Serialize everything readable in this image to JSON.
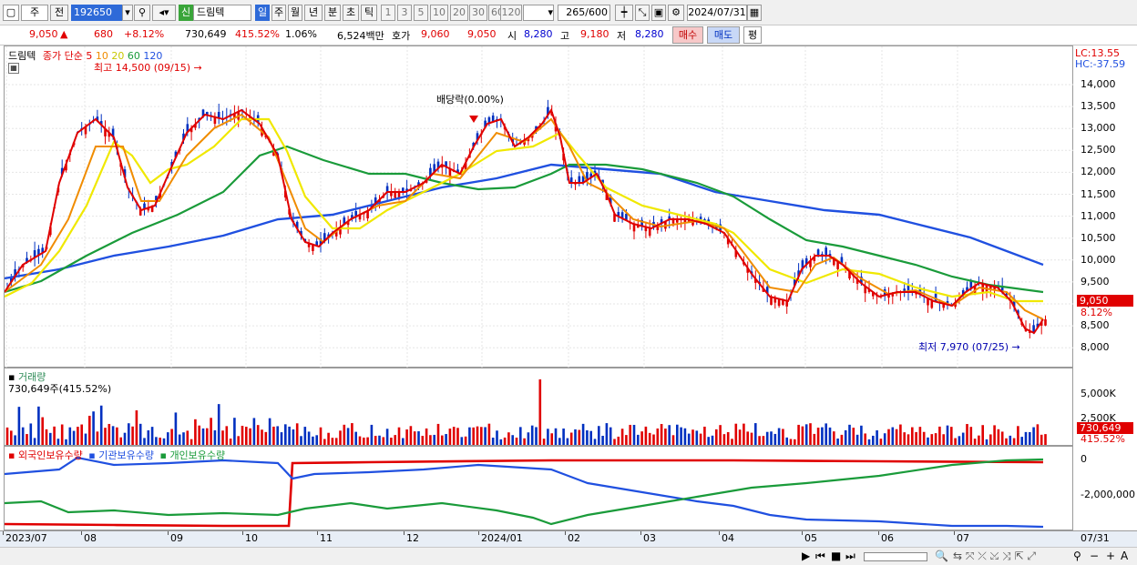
{
  "toolbar": {
    "period": "주",
    "prev": "전",
    "code": "192650",
    "credit": "신",
    "name": "드림텍",
    "periods": [
      "일",
      "주",
      "월",
      "년",
      "분",
      "초",
      "틱"
    ],
    "intervals": [
      "1",
      "3",
      "5",
      "10",
      "20",
      "30",
      "60",
      "120"
    ],
    "count": "265",
    "count_max": "/600",
    "date": "2024/07/31"
  },
  "quote": {
    "price": "9,050",
    "arrow": "▲",
    "change": "680",
    "change_pct": "+8.12%",
    "volume": "730,649",
    "vol_ratio": "415.52%",
    "turnover": "1.06%",
    "amount": "6,524백만",
    "hoga_label": "호가",
    "ask": "9,060",
    "bid": "9,050",
    "open_label": "시",
    "open": "8,280",
    "high_label": "고",
    "high": "9,180",
    "low_label": "저",
    "low": "8,280",
    "buy": "매수",
    "sell": "매도",
    "eval": "평"
  },
  "price_panel": {
    "stock": "드림텍",
    "legend_prefix": "종가 단순",
    "ma": [
      {
        "p": "5",
        "color": "#e00000"
      },
      {
        "p": "10",
        "color": "#f08c00"
      },
      {
        "p": "20",
        "color": "#e8e800"
      },
      {
        "p": "60",
        "color": "#1a9b3a"
      },
      {
        "p": "120",
        "color": "#2050e0"
      }
    ],
    "high_note": "최고 14,500 (09/15)",
    "low_note": "최저 7,970 (07/25)",
    "div_note": "배당락(0.00%)",
    "lc": "LC:13.55",
    "hc": "HC:-37.59",
    "y_labels": [
      "14,000",
      "13,500",
      "13,000",
      "12,500",
      "12,000",
      "11,500",
      "11,000",
      "10,500",
      "10,000",
      "9,500",
      "9,000",
      "8,500",
      "8,000"
    ],
    "cur_price": "9,050",
    "cur_pct": "8.12%"
  },
  "volume_panel": {
    "title": "거래량",
    "info": "730,649주(415.52%)",
    "y_labels": [
      "5,000K",
      "2,500K"
    ],
    "cur": "730,649",
    "cur_pct": "415.52%"
  },
  "holding_panel": {
    "series": [
      {
        "name": "외국인보유수량",
        "color": "#e00000"
      },
      {
        "name": "기관보유수량",
        "color": "#2050e0"
      },
      {
        "name": "개인보유수량",
        "color": "#1a9b3a"
      }
    ],
    "y_labels": [
      "0",
      "-2,000,000"
    ]
  },
  "x_labels": [
    "2023/07",
    "08",
    "09",
    "10",
    "11",
    "12",
    "2024/01",
    "02",
    "03",
    "04",
    "05",
    "06",
    "07"
  ],
  "x_right": "07/31"
}
